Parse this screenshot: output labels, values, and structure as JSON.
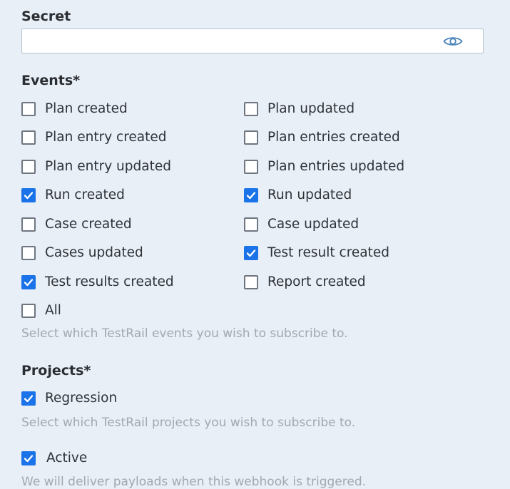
{
  "secret": {
    "label": "Secret",
    "value": ""
  },
  "events": {
    "label": "Events*",
    "left": [
      {
        "label": "Plan created",
        "checked": false
      },
      {
        "label": "Plan entry created",
        "checked": false
      },
      {
        "label": "Plan entry updated",
        "checked": false
      },
      {
        "label": "Run created",
        "checked": true
      },
      {
        "label": "Case created",
        "checked": false
      },
      {
        "label": "Cases updated",
        "checked": false
      },
      {
        "label": "Test results created",
        "checked": true
      },
      {
        "label": "All",
        "checked": false
      }
    ],
    "right": [
      {
        "label": "Plan updated",
        "checked": false
      },
      {
        "label": "Plan entries created",
        "checked": false
      },
      {
        "label": "Plan entries updated",
        "checked": false
      },
      {
        "label": "Run updated",
        "checked": true
      },
      {
        "label": "Case updated",
        "checked": false
      },
      {
        "label": "Test result created",
        "checked": true
      },
      {
        "label": "Report created",
        "checked": false
      }
    ],
    "hint": "Select which TestRail events you wish to subscribe to."
  },
  "projects": {
    "label": "Projects*",
    "items": [
      {
        "label": "Regression",
        "checked": true
      }
    ],
    "hint": "Select which TestRail projects you wish to subscribe to."
  },
  "active": {
    "label": "Active",
    "checked": true,
    "hint": "We will deliver payloads when this webhook is triggered."
  },
  "colors": {
    "accent": "#1a73e8",
    "background": "#e8eff7"
  },
  "icons": {
    "reveal": "eye-icon",
    "check": "checkmark-icon"
  }
}
